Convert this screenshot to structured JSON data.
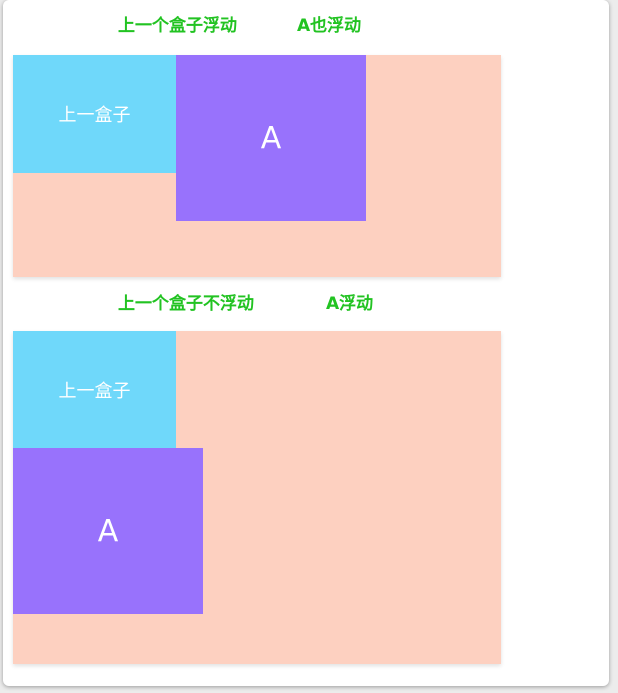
{
  "colors": {
    "caption": "#22c322",
    "container": "#fdd0c0",
    "prev_box": "#6fd8fa",
    "box_a": "#9872fc",
    "label": "#ffffff"
  },
  "example1": {
    "caption_left": "上一个盒子浮动",
    "caption_right": "A也浮动",
    "prev_label": "上一盒子",
    "a_label": "A"
  },
  "example2": {
    "caption_left": "上一个盒子不浮动",
    "caption_right": "A浮动",
    "prev_label": "上一盒子",
    "a_label": "A"
  }
}
